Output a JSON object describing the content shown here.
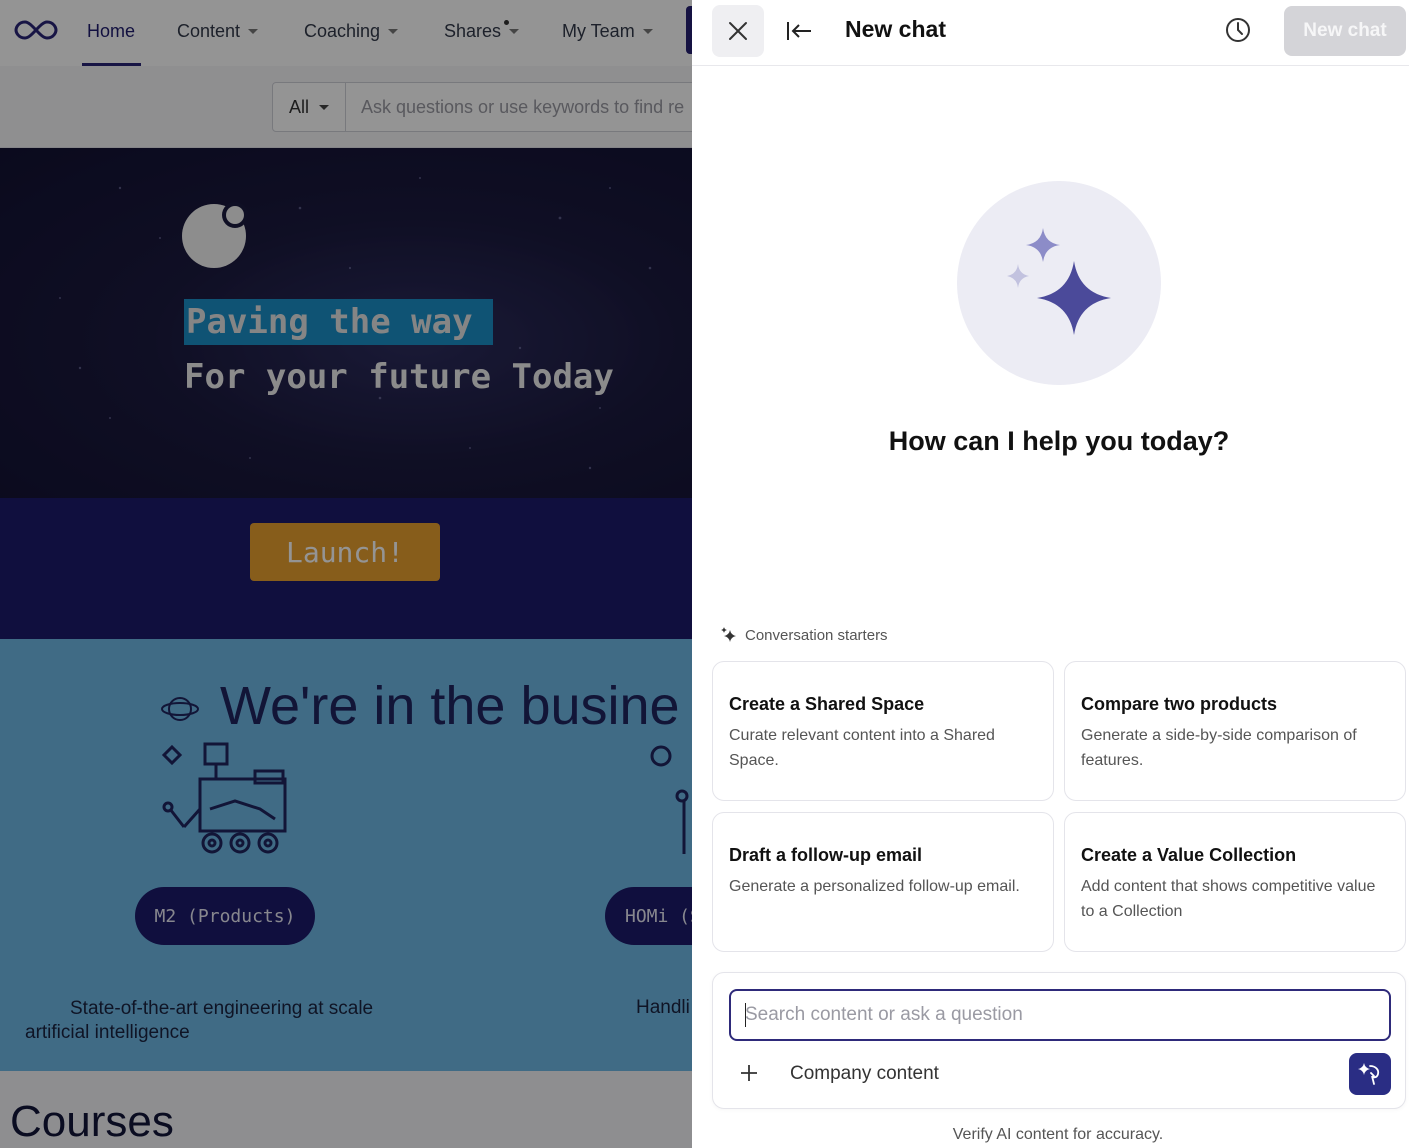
{
  "nav": {
    "items": [
      {
        "label": "Home"
      },
      {
        "label": "Content"
      },
      {
        "label": "Coaching"
      },
      {
        "label": "Shares"
      },
      {
        "label": "My Team"
      }
    ]
  },
  "search": {
    "scope": "All",
    "placeholder": "Ask questions or use keywords to find re"
  },
  "hero": {
    "line1": "Paving the way",
    "line2": "For your future Today",
    "launch_label": "Launch!"
  },
  "business": {
    "title": "We're in the busine",
    "pills": [
      "M2 (Products)",
      "HOMi (S"
    ],
    "desc1_line1": "State-of-the-art engineering at scale",
    "desc1_line2": "artificial intelligence",
    "desc2": "Handli"
  },
  "courses": {
    "title": "Courses"
  },
  "panel": {
    "title": "New chat",
    "new_chat_label": "New chat",
    "greeting": "How can I help you today?",
    "starters_label": "Conversation starters",
    "starters": [
      {
        "title": "Create a Shared Space",
        "desc": "Curate relevant content into a Shared Space."
      },
      {
        "title": "Compare two products",
        "desc": "Generate a side-by-side comparison of features."
      },
      {
        "title": "Draft a follow-up email",
        "desc": "Generate a personalized follow-up email."
      },
      {
        "title": "Create a Value Collection",
        "desc": "Add content that shows competitive value to a Collection"
      }
    ],
    "input_placeholder": "Search content or ask a question",
    "input_value": "",
    "source_label": "Company content",
    "disclaimer": "Verify AI content for accuracy."
  },
  "colors": {
    "brand": "#2a2d84",
    "hero_highlight": "#1a8fc8",
    "launch": "#e9a030",
    "business_bg": "#6fb8e6"
  },
  "icons": [
    "logo-icon",
    "close-icon",
    "collapse-left-icon",
    "history-icon",
    "sparkle-icon",
    "plus-icon",
    "send-ai-icon",
    "planet-icon",
    "robot-icon"
  ]
}
